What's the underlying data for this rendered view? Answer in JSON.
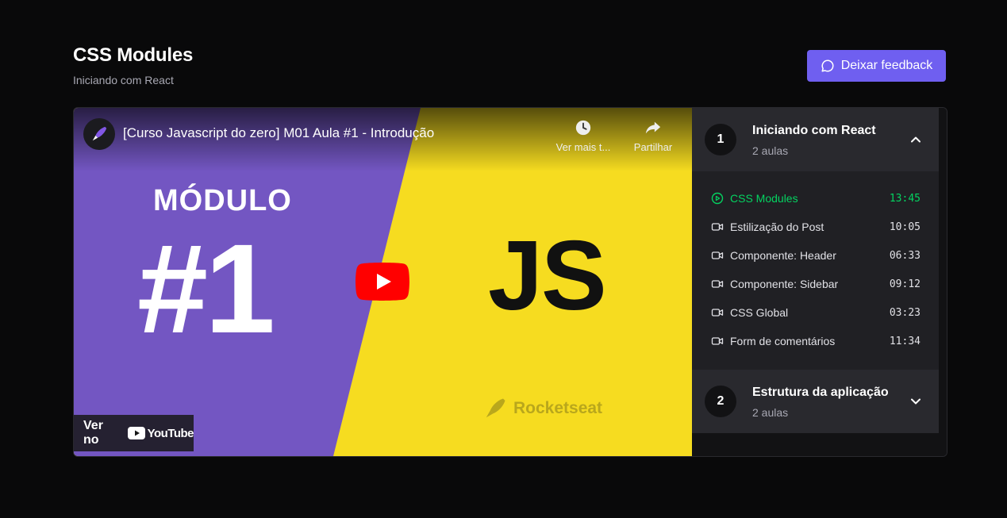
{
  "page": {
    "title": "CSS Modules",
    "subtitle": "Iniciando com React",
    "feedback_label": "Deixar feedback"
  },
  "video": {
    "title": "[Curso Javascript do zero] M01 Aula #1 - Introdução",
    "watch_later_label": "Ver mais t...",
    "share_label": "Partilhar",
    "modulo_text": "MÓDULO",
    "number_text": "#1",
    "js_text": "JS",
    "brand_text": "Rocketseat",
    "watch_on_label": "Ver no",
    "youtube_label": "YouTube",
    "colors": {
      "left_bg": "#7356c2",
      "right_bg": "#f6dc20",
      "play": "#ff0000"
    }
  },
  "modules": [
    {
      "number": "1",
      "title": "Iniciando com React",
      "count": "2 aulas",
      "expanded": true,
      "lessons": [
        {
          "title": "CSS Modules",
          "time": "13:45",
          "icon": "play-circle-icon",
          "active": true
        },
        {
          "title": "Estilização do Post",
          "time": "10:05",
          "icon": "video-camera-icon",
          "active": false
        },
        {
          "title": "Componente: Header",
          "time": "06:33",
          "icon": "video-camera-icon",
          "active": false
        },
        {
          "title": "Componente: Sidebar",
          "time": "09:12",
          "icon": "video-camera-icon",
          "active": false
        },
        {
          "title": "CSS Global",
          "time": "03:23",
          "icon": "video-camera-icon",
          "active": false
        },
        {
          "title": "Form de comentários",
          "time": "11:34",
          "icon": "video-camera-icon",
          "active": false
        }
      ]
    },
    {
      "number": "2",
      "title": "Estrutura da aplicação",
      "count": "2 aulas",
      "expanded": false,
      "lessons": []
    }
  ],
  "colors": {
    "background": "#09090a",
    "accent": "#6f5ff0",
    "active_lesson": "#04d361"
  }
}
